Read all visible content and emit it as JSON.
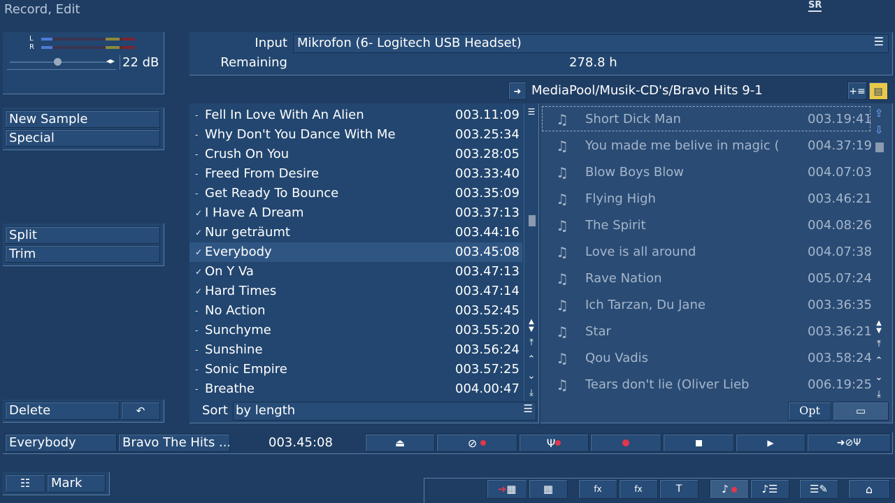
{
  "window": {
    "title": "Record, Edit",
    "logo_text": "SR"
  },
  "meter": {
    "left_label": "L",
    "right_label": "R",
    "db_value": "22 dB",
    "slider_level": 0.45
  },
  "sample_buttons": {
    "new_sample": "New Sample",
    "special": "Special"
  },
  "edit_buttons": {
    "split": "Split",
    "trim": "Trim"
  },
  "delete": {
    "label": "Delete"
  },
  "input": {
    "label": "Input",
    "value": "Mikrofon (6- Logitech USB Headset)",
    "remaining_label": "Remaining",
    "remaining_value": "278.8 h"
  },
  "pool": {
    "path": "MediaPool/Musik-CD's/Bravo Hits 9-1",
    "items": [
      {
        "title": "Short Dick Man",
        "duration": "003.19:41"
      },
      {
        "title": "You made me belive in magic (",
        "duration": "004.37:19"
      },
      {
        "title": "Blow Boys Blow",
        "duration": "004.07:03"
      },
      {
        "title": "Flying High",
        "duration": "003.46:21"
      },
      {
        "title": "The Spirit",
        "duration": "004.08:26"
      },
      {
        "title": "Love is all around",
        "duration": "004.07:38"
      },
      {
        "title": "Rave Nation",
        "duration": "005.07:24"
      },
      {
        "title": "Ich Tarzan, Du Jane",
        "duration": "003.36:35"
      },
      {
        "title": "Star",
        "duration": "003.36:21"
      },
      {
        "title": "Qou Vadis",
        "duration": "003.58:24"
      },
      {
        "title": "Tears don't lie (Oliver Lieb",
        "duration": "006.19:25"
      }
    ],
    "opt_label": "Opt"
  },
  "tracks": {
    "items": [
      {
        "mark": "-",
        "title": "Fell In Love With An Alien",
        "duration": "003.11:09"
      },
      {
        "mark": "-",
        "title": "Why Don't You Dance With Me",
        "duration": "003.25:34"
      },
      {
        "mark": "-",
        "title": "Crush On You",
        "duration": "003.28:05"
      },
      {
        "mark": "-",
        "title": "Freed From Desire",
        "duration": "003.33:40"
      },
      {
        "mark": "-",
        "title": "Get Ready To Bounce",
        "duration": "003.35:09"
      },
      {
        "mark": "✓",
        "title": "I Have A Dream",
        "duration": "003.37:13"
      },
      {
        "mark": "✓",
        "title": "Nur geträumt",
        "duration": "003.44:16"
      },
      {
        "mark": "✓",
        "title": "Everybody",
        "duration": "003.45:08"
      },
      {
        "mark": "✓",
        "title": "On Y Va",
        "duration": "003.47:13"
      },
      {
        "mark": "✓",
        "title": "Hard Times",
        "duration": "003.47:14"
      },
      {
        "mark": "-",
        "title": "No Action",
        "duration": "003.52:45"
      },
      {
        "mark": "-",
        "title": "Sunchyme",
        "duration": "003.55:20"
      },
      {
        "mark": "-",
        "title": "Sunshine",
        "duration": "003.56:24"
      },
      {
        "mark": "-",
        "title": "Sonic Empire",
        "duration": "003.57:25"
      },
      {
        "mark": "-",
        "title": "Breathe",
        "duration": "004.00:47"
      }
    ],
    "sort_label": "Sort",
    "sort_value": "by length"
  },
  "status": {
    "current_title": "Everybody",
    "current_album": "Bravo The Hits ...",
    "current_time": "003.45:08"
  },
  "bottom": {
    "mark_label": "Mark"
  },
  "colors": {
    "accent_red": "#e0374d",
    "background": "#1f3d63",
    "panel": "#22466f"
  }
}
